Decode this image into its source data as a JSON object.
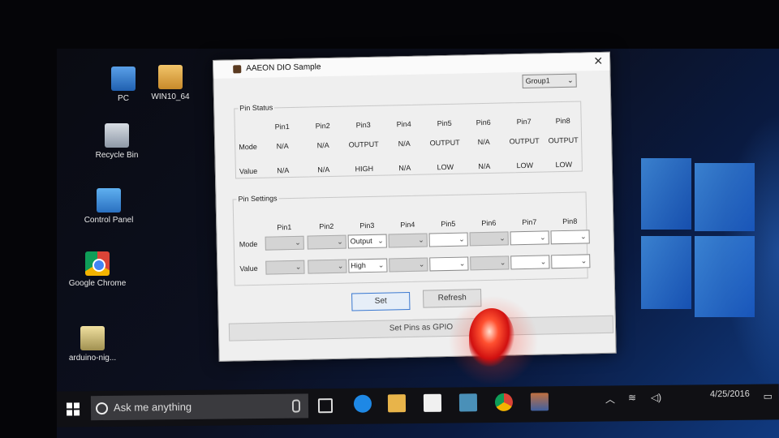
{
  "desktop": {
    "icons": [
      {
        "label": "PC"
      },
      {
        "label": "WIN10_64"
      },
      {
        "label": "Recycle Bin"
      },
      {
        "label": "Control Panel"
      },
      {
        "label": "Google Chrome"
      },
      {
        "label": "arduino-nig..."
      }
    ]
  },
  "dialog": {
    "title": "AAEON DIO Sample",
    "close_symbol": "✕",
    "group_select": "Group1",
    "pin_status": {
      "legend": "Pin Status",
      "headers": [
        "Pin1",
        "Pin2",
        "Pin3",
        "Pin4",
        "Pin5",
        "Pin6",
        "Pin7",
        "Pin8"
      ],
      "mode_label": "Mode",
      "value_label": "Value",
      "modes": [
        "N/A",
        "N/A",
        "OUTPUT",
        "N/A",
        "OUTPUT",
        "N/A",
        "OUTPUT",
        "OUTPUT"
      ],
      "values": [
        "N/A",
        "N/A",
        "HIGH",
        "N/A",
        "LOW",
        "N/A",
        "LOW",
        "LOW"
      ]
    },
    "pin_settings": {
      "legend": "Pin Settings",
      "headers": [
        "Pin1",
        "Pin2",
        "Pin3",
        "Pin4",
        "Pin5",
        "Pin6",
        "Pin7",
        "Pin8"
      ],
      "mode_label": "Mode",
      "value_label": "Value",
      "mode_values": [
        "",
        "",
        "Output",
        "",
        "",
        "",
        "",
        ""
      ],
      "value_values": [
        "",
        "",
        "High",
        "",
        "",
        "",
        "",
        ""
      ]
    },
    "set_button": "Set",
    "refresh_button": "Refresh",
    "gpio_button": "Set Pins as GPIO"
  },
  "taskbar": {
    "search_placeholder": "Ask me anything",
    "clock": "4/25/2016"
  }
}
